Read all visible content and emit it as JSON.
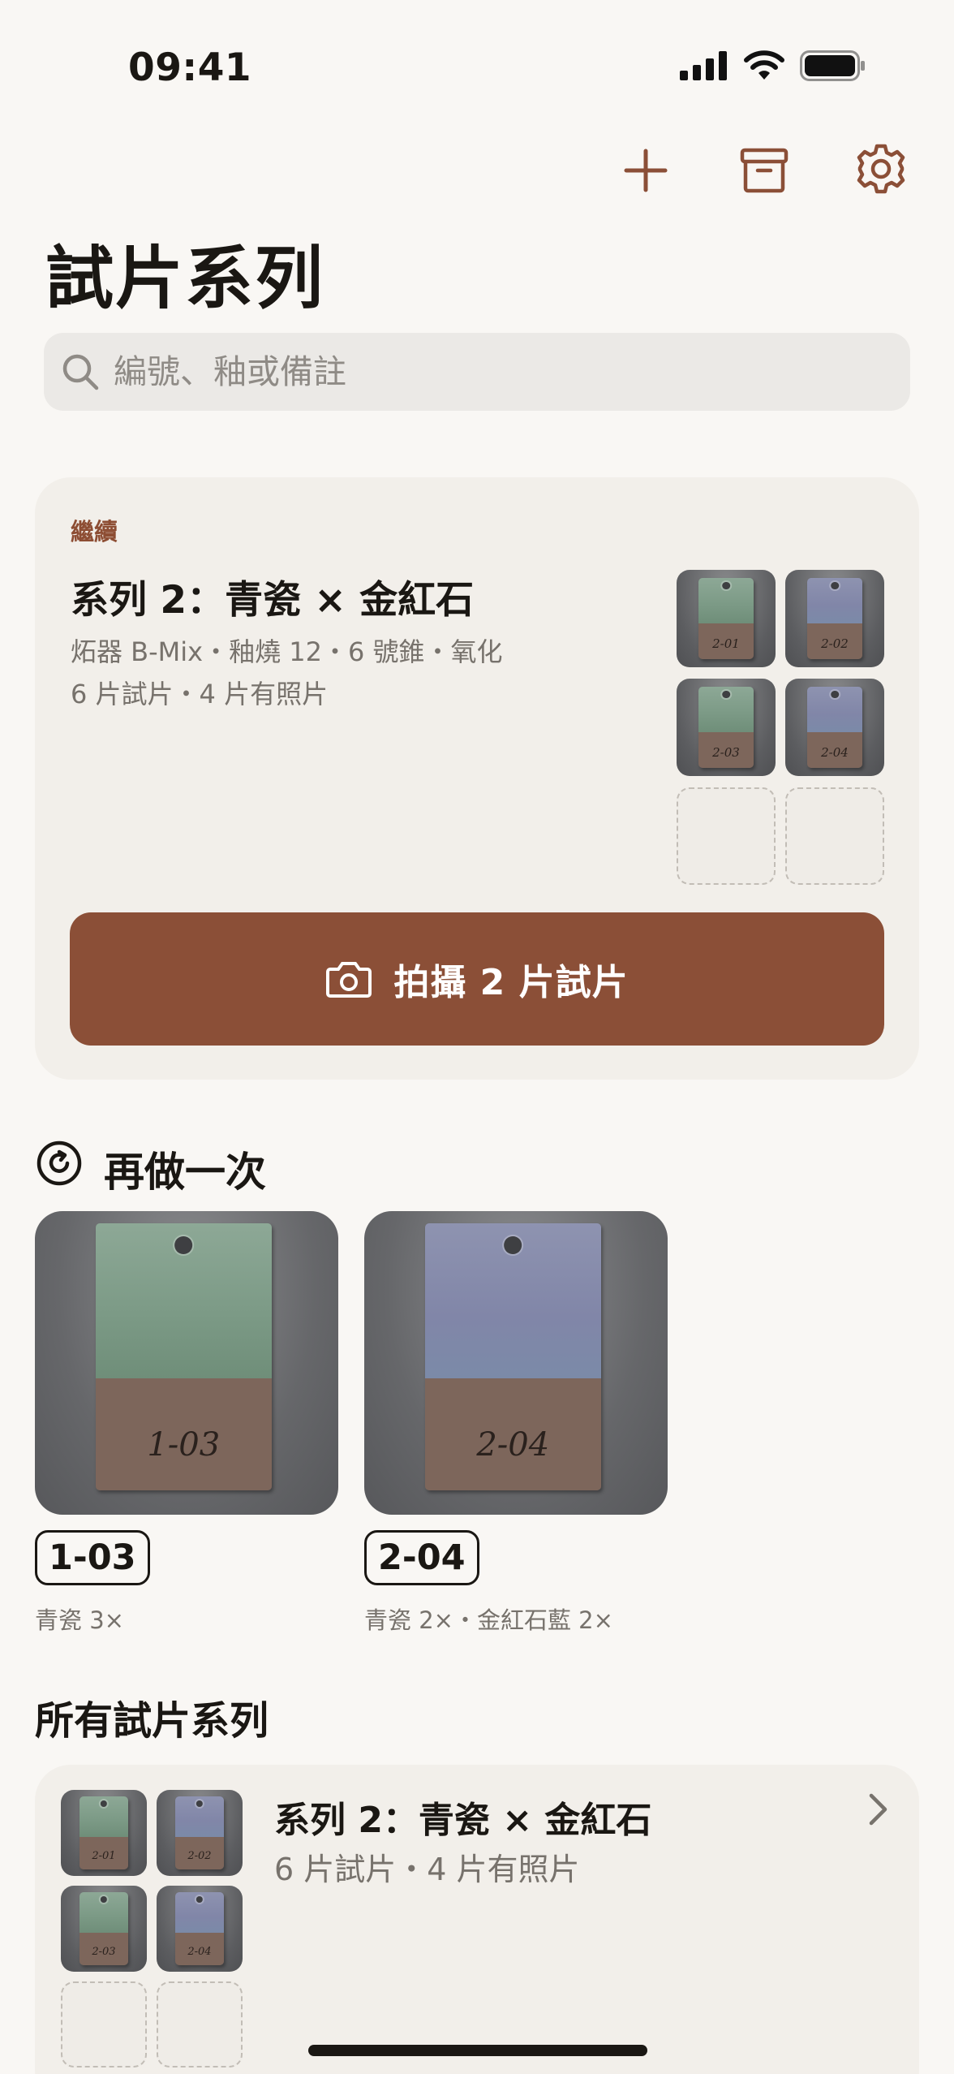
{
  "status_bar": {
    "time": "09:41"
  },
  "nav": {
    "add_icon": "plus-icon",
    "archive_icon": "archive-icon",
    "settings_icon": "gear-icon"
  },
  "page_title": "試片系列",
  "search": {
    "placeholder": "編號、釉或備註"
  },
  "continue_card": {
    "eyebrow": "繼續",
    "title": "系列 2：青瓷 × 金紅石",
    "meta_line1": "炻器 B-Mix・釉燒 12・6 號錐・氧化",
    "meta_line2": "6 片試片・4 片有照片",
    "tiles": [
      "2-01",
      "2-02",
      "2-03",
      "2-04"
    ],
    "button_label": "拍攝 2 片試片"
  },
  "redo_section": {
    "heading": "再做一次",
    "items": [
      {
        "code": "1-03",
        "recipe": "青瓷 3×"
      },
      {
        "code": "2-04",
        "recipe": "青瓷 2×・金紅石藍 2×"
      }
    ]
  },
  "all_series": {
    "heading": "所有試片系列",
    "items": [
      {
        "title": "系列 2：青瓷 × 金紅石",
        "subtitle": "6 片試片・4 片有照片",
        "tiles": [
          "2-01",
          "2-02",
          "2-03",
          "2-04"
        ]
      }
    ]
  },
  "colors": {
    "accent": "#8b4f37",
    "background": "#f9f7f4",
    "card": "#f2efea"
  }
}
